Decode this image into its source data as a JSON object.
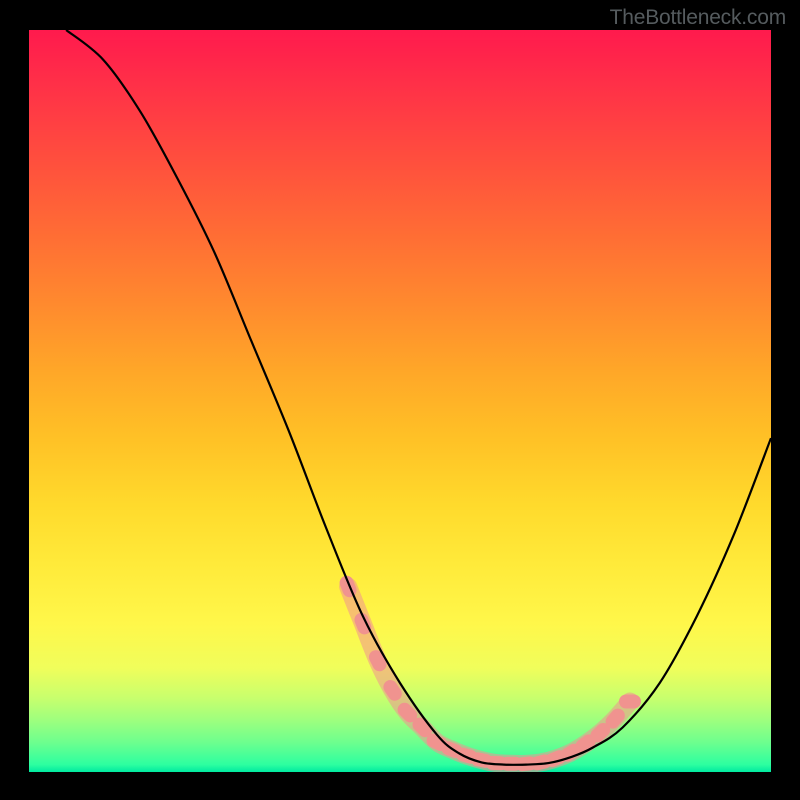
{
  "watermark": "TheBottleneck.com",
  "chart_data": {
    "type": "line",
    "title": "",
    "xlabel": "",
    "ylabel": "",
    "xlim": [
      0,
      100
    ],
    "ylim": [
      0,
      100
    ],
    "grid": false,
    "series": [
      {
        "name": "curve",
        "color": "#000000",
        "x": [
          5,
          10,
          15,
          20,
          25,
          30,
          35,
          40,
          45,
          50,
          55,
          58,
          61,
          64,
          67,
          70,
          73,
          76,
          80,
          85,
          90,
          95,
          100
        ],
        "values": [
          100,
          96,
          89,
          80,
          70,
          58,
          46,
          33,
          21,
          12,
          5,
          2.5,
          1.3,
          1,
          1,
          1.2,
          2,
          3.3,
          6,
          12,
          21,
          32,
          45
        ]
      },
      {
        "name": "pink-band",
        "color": "#f0938f",
        "x": [
          43,
          45,
          47,
          49,
          51,
          53,
          55,
          57,
          59,
          61,
          63,
          65,
          67,
          69,
          71,
          73,
          75,
          77,
          79,
          81
        ],
        "values": [
          25,
          20,
          15,
          11,
          8,
          6,
          4,
          3,
          2.2,
          1.6,
          1.2,
          1.1,
          1.1,
          1.3,
          1.8,
          2.6,
          3.8,
          5.3,
          7.2,
          9.5
        ]
      }
    ]
  }
}
